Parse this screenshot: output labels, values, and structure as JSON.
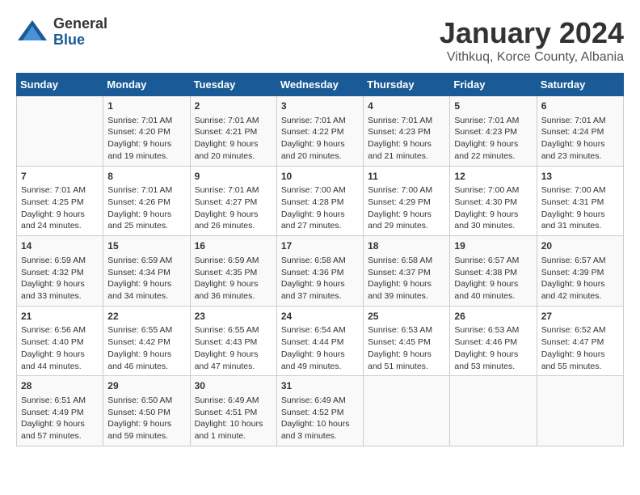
{
  "logo": {
    "general": "General",
    "blue": "Blue"
  },
  "title": "January 2024",
  "subtitle": "Vithkuq, Korce County, Albania",
  "headers": [
    "Sunday",
    "Monday",
    "Tuesday",
    "Wednesday",
    "Thursday",
    "Friday",
    "Saturday"
  ],
  "weeks": [
    [
      {
        "day": "",
        "info": ""
      },
      {
        "day": "1",
        "info": "Sunrise: 7:01 AM\nSunset: 4:20 PM\nDaylight: 9 hours\nand 19 minutes."
      },
      {
        "day": "2",
        "info": "Sunrise: 7:01 AM\nSunset: 4:21 PM\nDaylight: 9 hours\nand 20 minutes."
      },
      {
        "day": "3",
        "info": "Sunrise: 7:01 AM\nSunset: 4:22 PM\nDaylight: 9 hours\nand 20 minutes."
      },
      {
        "day": "4",
        "info": "Sunrise: 7:01 AM\nSunset: 4:23 PM\nDaylight: 9 hours\nand 21 minutes."
      },
      {
        "day": "5",
        "info": "Sunrise: 7:01 AM\nSunset: 4:23 PM\nDaylight: 9 hours\nand 22 minutes."
      },
      {
        "day": "6",
        "info": "Sunrise: 7:01 AM\nSunset: 4:24 PM\nDaylight: 9 hours\nand 23 minutes."
      }
    ],
    [
      {
        "day": "7",
        "info": "Sunrise: 7:01 AM\nSunset: 4:25 PM\nDaylight: 9 hours\nand 24 minutes."
      },
      {
        "day": "8",
        "info": "Sunrise: 7:01 AM\nSunset: 4:26 PM\nDaylight: 9 hours\nand 25 minutes."
      },
      {
        "day": "9",
        "info": "Sunrise: 7:01 AM\nSunset: 4:27 PM\nDaylight: 9 hours\nand 26 minutes."
      },
      {
        "day": "10",
        "info": "Sunrise: 7:00 AM\nSunset: 4:28 PM\nDaylight: 9 hours\nand 27 minutes."
      },
      {
        "day": "11",
        "info": "Sunrise: 7:00 AM\nSunset: 4:29 PM\nDaylight: 9 hours\nand 29 minutes."
      },
      {
        "day": "12",
        "info": "Sunrise: 7:00 AM\nSunset: 4:30 PM\nDaylight: 9 hours\nand 30 minutes."
      },
      {
        "day": "13",
        "info": "Sunrise: 7:00 AM\nSunset: 4:31 PM\nDaylight: 9 hours\nand 31 minutes."
      }
    ],
    [
      {
        "day": "14",
        "info": "Sunrise: 6:59 AM\nSunset: 4:32 PM\nDaylight: 9 hours\nand 33 minutes."
      },
      {
        "day": "15",
        "info": "Sunrise: 6:59 AM\nSunset: 4:34 PM\nDaylight: 9 hours\nand 34 minutes."
      },
      {
        "day": "16",
        "info": "Sunrise: 6:59 AM\nSunset: 4:35 PM\nDaylight: 9 hours\nand 36 minutes."
      },
      {
        "day": "17",
        "info": "Sunrise: 6:58 AM\nSunset: 4:36 PM\nDaylight: 9 hours\nand 37 minutes."
      },
      {
        "day": "18",
        "info": "Sunrise: 6:58 AM\nSunset: 4:37 PM\nDaylight: 9 hours\nand 39 minutes."
      },
      {
        "day": "19",
        "info": "Sunrise: 6:57 AM\nSunset: 4:38 PM\nDaylight: 9 hours\nand 40 minutes."
      },
      {
        "day": "20",
        "info": "Sunrise: 6:57 AM\nSunset: 4:39 PM\nDaylight: 9 hours\nand 42 minutes."
      }
    ],
    [
      {
        "day": "21",
        "info": "Sunrise: 6:56 AM\nSunset: 4:40 PM\nDaylight: 9 hours\nand 44 minutes."
      },
      {
        "day": "22",
        "info": "Sunrise: 6:55 AM\nSunset: 4:42 PM\nDaylight: 9 hours\nand 46 minutes."
      },
      {
        "day": "23",
        "info": "Sunrise: 6:55 AM\nSunset: 4:43 PM\nDaylight: 9 hours\nand 47 minutes."
      },
      {
        "day": "24",
        "info": "Sunrise: 6:54 AM\nSunset: 4:44 PM\nDaylight: 9 hours\nand 49 minutes."
      },
      {
        "day": "25",
        "info": "Sunrise: 6:53 AM\nSunset: 4:45 PM\nDaylight: 9 hours\nand 51 minutes."
      },
      {
        "day": "26",
        "info": "Sunrise: 6:53 AM\nSunset: 4:46 PM\nDaylight: 9 hours\nand 53 minutes."
      },
      {
        "day": "27",
        "info": "Sunrise: 6:52 AM\nSunset: 4:47 PM\nDaylight: 9 hours\nand 55 minutes."
      }
    ],
    [
      {
        "day": "28",
        "info": "Sunrise: 6:51 AM\nSunset: 4:49 PM\nDaylight: 9 hours\nand 57 minutes."
      },
      {
        "day": "29",
        "info": "Sunrise: 6:50 AM\nSunset: 4:50 PM\nDaylight: 9 hours\nand 59 minutes."
      },
      {
        "day": "30",
        "info": "Sunrise: 6:49 AM\nSunset: 4:51 PM\nDaylight: 10 hours\nand 1 minute."
      },
      {
        "day": "31",
        "info": "Sunrise: 6:49 AM\nSunset: 4:52 PM\nDaylight: 10 hours\nand 3 minutes."
      },
      {
        "day": "",
        "info": ""
      },
      {
        "day": "",
        "info": ""
      },
      {
        "day": "",
        "info": ""
      }
    ]
  ]
}
